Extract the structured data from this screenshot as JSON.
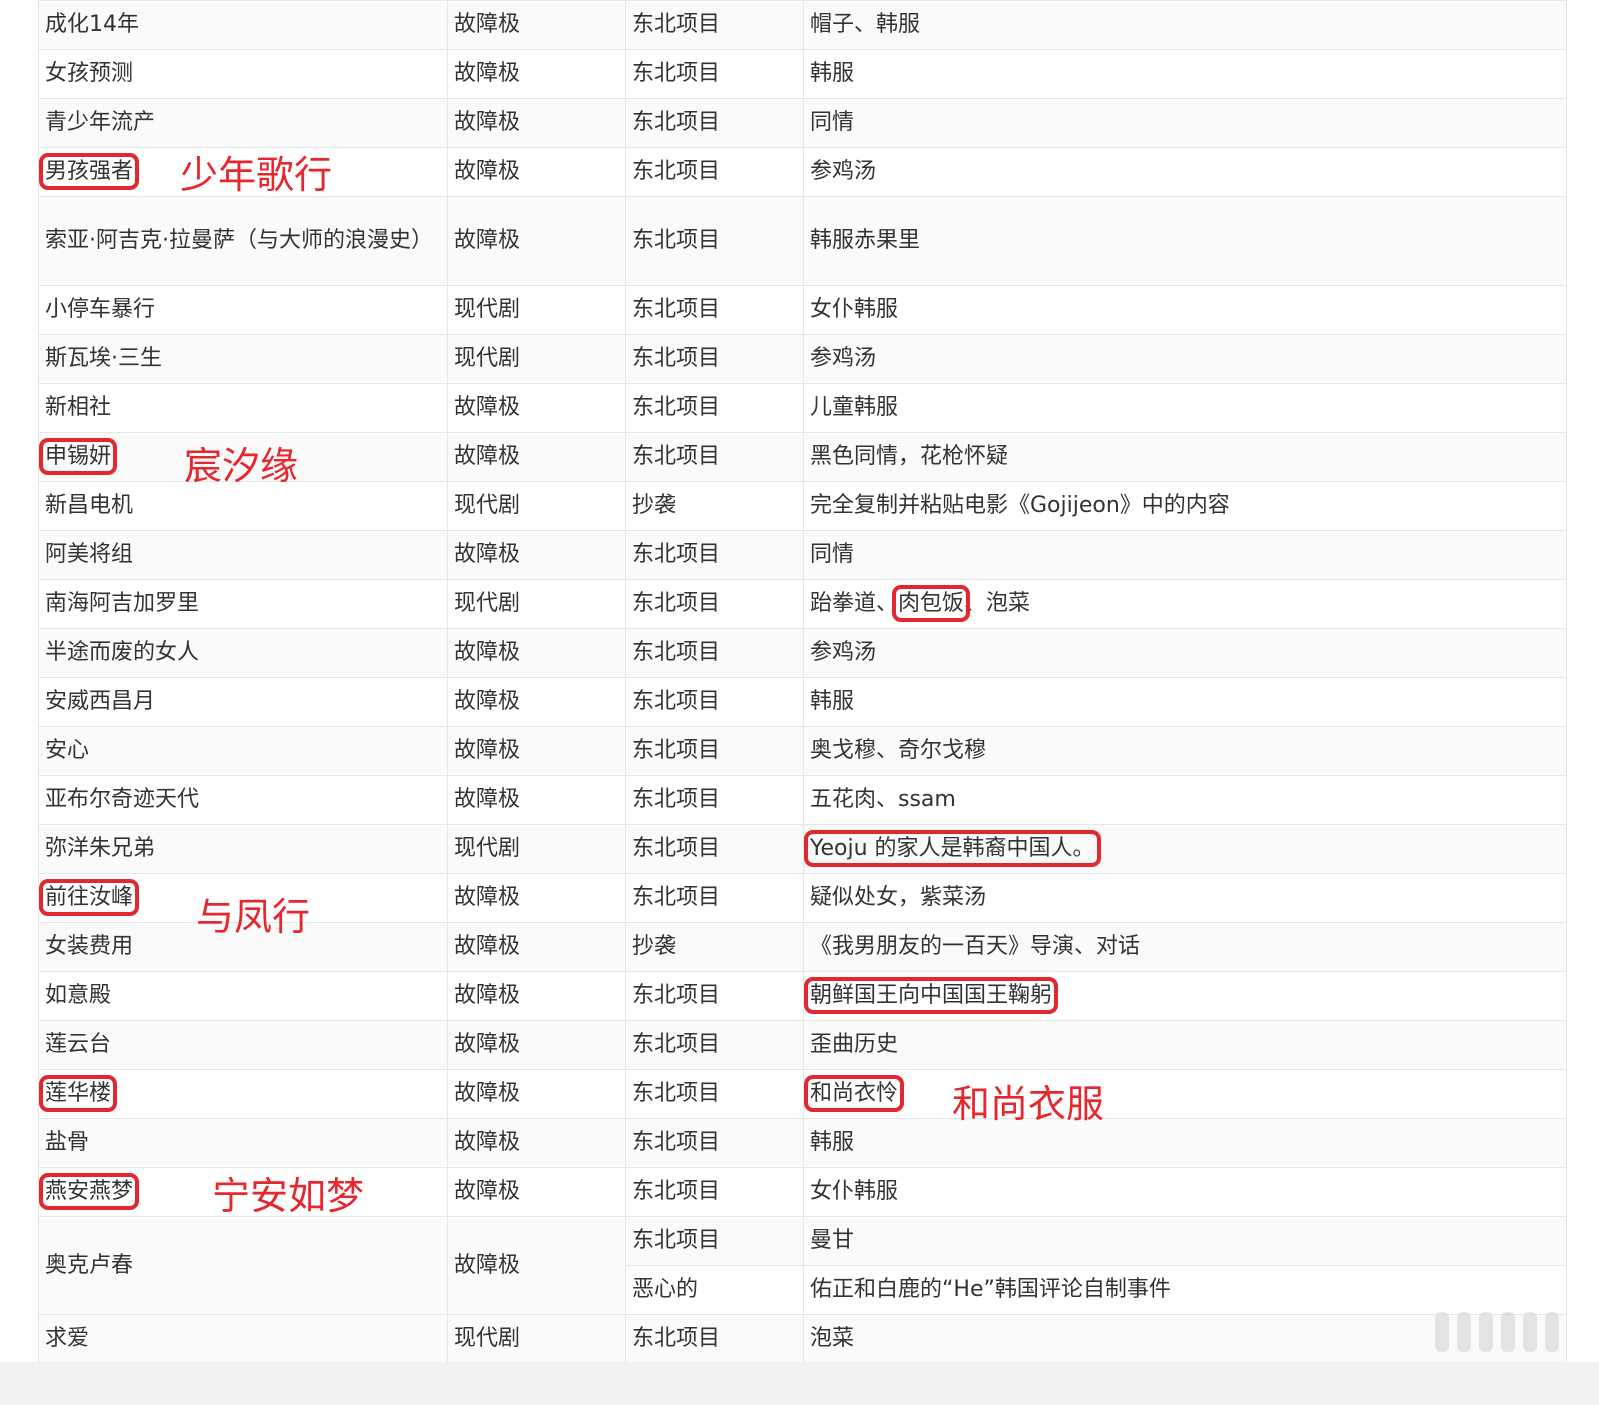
{
  "rows": [
    {
      "title": "成化14年",
      "genre": "故障极",
      "type": "东北项目",
      "note": "帽子、韩服"
    },
    {
      "title": "女孩预测",
      "genre": "故障极",
      "type": "东北项目",
      "note": "韩服"
    },
    {
      "title": "青少年流产",
      "genre": "故障极",
      "type": "东北项目",
      "note": "同情"
    },
    {
      "title": "男孩强者",
      "genre": "故障极",
      "type": "东北项目",
      "note": "参鸡汤"
    },
    {
      "title": "索亚·阿吉克·拉曼萨（与大师的浪漫史）",
      "genre": "故障极",
      "type": "东北项目",
      "note": "韩服赤果里"
    },
    {
      "title": "小停车暴行",
      "genre": "现代剧",
      "type": "东北项目",
      "note": "女仆韩服"
    },
    {
      "title": "斯瓦埃·三生",
      "genre": "现代剧",
      "type": "东北项目",
      "note": "参鸡汤"
    },
    {
      "title": "新相社",
      "genre": "故障极",
      "type": "东北项目",
      "note": "儿童韩服"
    },
    {
      "title": "申锡妍",
      "genre": "故障极",
      "type": "东北项目",
      "note": "黑色同情，花枪怀疑"
    },
    {
      "title": "新昌电机",
      "genre": "现代剧",
      "type": "抄袭",
      "note": "完全复制并粘贴电影《Gojijeon》中的内容"
    },
    {
      "title": "阿美将组",
      "genre": "故障极",
      "type": "东北项目",
      "note": "同情"
    },
    {
      "title": "南海阿吉加罗里",
      "genre": "现代剧",
      "type": "东北项目",
      "note_pre": "跆拳道、",
      "note_hl": "肉包饭",
      "note_post": "、泡菜"
    },
    {
      "title": "半途而废的女人",
      "genre": "故障极",
      "type": "东北项目",
      "note": "参鸡汤"
    },
    {
      "title": "安威西昌月",
      "genre": "故障极",
      "type": "东北项目",
      "note": "韩服"
    },
    {
      "title": "安心",
      "genre": "故障极",
      "type": "东北项目",
      "note": "奥戈穆、奇尔戈穆"
    },
    {
      "title": "亚布尔奇迹天代",
      "genre": "故障极",
      "type": "东北项目",
      "note": "五花肉、ssam"
    },
    {
      "title": "弥洋朱兄弟",
      "genre": "现代剧",
      "type": "东北项目",
      "note": "Yeoju 的家人是韩裔中国人。"
    },
    {
      "title": "前往汝峰",
      "genre": "故障极",
      "type": "东北项目",
      "note": "疑似处女，紫菜汤"
    },
    {
      "title": "女装费用",
      "genre": "故障极",
      "type": "抄袭",
      "note": "《我男朋友的一百天》导演、对话"
    },
    {
      "title": "如意殿",
      "genre": "故障极",
      "type": "东北项目",
      "note": "朝鲜国王向中国国王鞠躬"
    },
    {
      "title": "莲云台",
      "genre": "故障极",
      "type": "东北项目",
      "note": "歪曲历史"
    },
    {
      "title": "莲华楼",
      "genre": "故障极",
      "type": "东北项目",
      "note": "和尚衣怜"
    },
    {
      "title": "盐骨",
      "genre": "故障极",
      "type": "东北项目",
      "note": "韩服"
    },
    {
      "title": "燕安燕梦",
      "genre": "故障极",
      "type": "东北项目",
      "note": "女仆韩服"
    },
    {
      "title": "奥克卢春",
      "genre": "故障极",
      "type": "东北项目",
      "note": "曼甘",
      "type2": "恶心的",
      "note2": "佑正和白鹿的“He”韩国评论自制事件"
    },
    {
      "title": "求爱",
      "genre": "现代剧",
      "type": "东北项目",
      "note": "泡菜"
    }
  ],
  "annotations": {
    "a1": "少年歌行",
    "a2": "宸汐缘",
    "a3": "与凤行",
    "a4": "和尚衣服",
    "a5": "宁安如梦"
  },
  "colors": {
    "highlight": "#e0282e",
    "annotation": "#e8262d",
    "border": "#e6e6e6"
  }
}
